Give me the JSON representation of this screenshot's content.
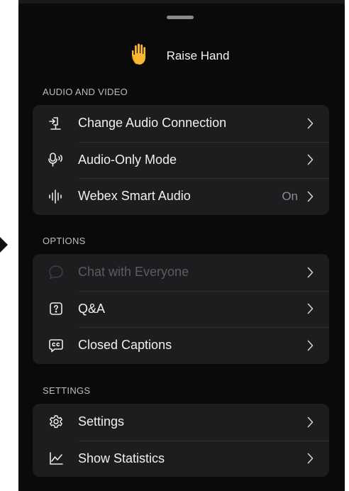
{
  "raise_hand": {
    "label": "Raise Hand",
    "icon": "raised-hand-icon"
  },
  "sections": {
    "audio_video": "AUDIO AND VIDEO",
    "options": "OPTIONS",
    "settings": "SETTINGS"
  },
  "audio_items": [
    {
      "label": "Change Audio Connection",
      "icon": "audio-connection-icon"
    },
    {
      "label": "Audio-Only Mode",
      "icon": "audio-only-icon"
    },
    {
      "label": "Webex Smart Audio",
      "icon": "waveform-icon",
      "value": "On"
    }
  ],
  "option_items": [
    {
      "label": "Chat with Everyone",
      "icon": "chat-bubble-icon",
      "disabled": true
    },
    {
      "label": "Q&A",
      "icon": "question-icon"
    },
    {
      "label": "Closed Captions",
      "icon": "closed-captions-icon"
    }
  ],
  "settings_items": [
    {
      "label": "Settings",
      "icon": "gear-icon"
    },
    {
      "label": "Show Statistics",
      "icon": "statistics-chart-icon"
    }
  ],
  "colors": {
    "sheet_bg": "#0a0a0a",
    "group_bg": "#1d1d1f",
    "hand": "#f7b731",
    "disabled_text": "#5d5d61"
  }
}
